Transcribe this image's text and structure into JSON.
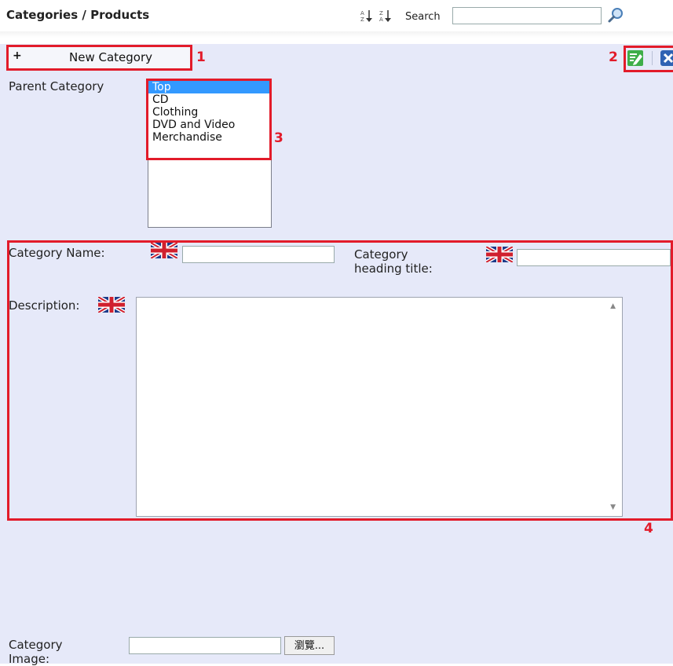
{
  "header": {
    "title": "Categories / Products",
    "sort_az_icon": "sort-ascending-icon",
    "sort_za_icon": "sort-descending-icon",
    "search_label": "Search",
    "search_value": "",
    "search_icon": "magnifier-icon"
  },
  "toolbar": {
    "new_category_label": "New Category",
    "plus_symbol": "+",
    "edit_icon": "edit-icon",
    "close_icon": "close-icon"
  },
  "markers": [
    "1",
    "2",
    "3",
    "4"
  ],
  "form": {
    "parent_category_label": "Parent Category",
    "parent_options": [
      "Top",
      "CD",
      "Clothing",
      "DVD and Video",
      "Merchandise"
    ],
    "selected_parent": "Top",
    "category_name_label": "Category Name:",
    "category_name_value": "",
    "heading_title_label_line1": "Category",
    "heading_title_label_line2": "heading title:",
    "heading_title_value": "",
    "description_label": "Description:",
    "description_value": "",
    "language_flag_icon": "uk-flag-icon",
    "image_label_line1": "Category",
    "image_label_line2": "Image:",
    "image_value": "",
    "browse_label": "瀏覽..."
  },
  "colors": {
    "panel_bg": "#e6e9f9",
    "annotation_red": "#e21b2a",
    "selection_blue": "#3399ff"
  }
}
